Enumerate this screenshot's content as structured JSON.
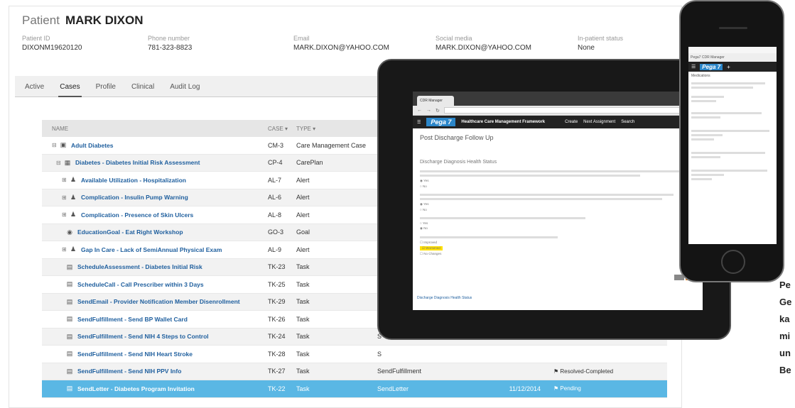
{
  "patient": {
    "label": "Patient",
    "name": "MARK DIXON"
  },
  "header": [
    {
      "label": "Patient ID",
      "value": "DIXONM19620120"
    },
    {
      "label": "Phone number",
      "value": "781-323-8823"
    },
    {
      "label": "Email",
      "value": "MARK.DIXON@YAHOO.COM"
    },
    {
      "label": "Social media",
      "value": "MARK.DIXON@YAHOO.COM"
    },
    {
      "label": "In-patient status",
      "value": "None"
    }
  ],
  "tabs": [
    "Active",
    "Cases",
    "Profile",
    "Clinical",
    "Audit Log"
  ],
  "columns": {
    "name": "NAME",
    "case": "CASE",
    "type": "TYPE"
  },
  "rows": [
    {
      "icon": "folder-icon",
      "name": "Adult Diabetes",
      "case": "CM-3",
      "type": "Care Management Case",
      "sub": "",
      "date": "",
      "status": ""
    },
    {
      "icon": "plan-icon",
      "name": "Diabetes - Diabetes Initial Risk Assessment",
      "case": "CP-4",
      "type": "CarePlan",
      "sub": "",
      "date": "",
      "status": ""
    },
    {
      "icon": "person-icon",
      "name": "Available Utilization - Hospitalization",
      "case": "AL-7",
      "type": "Alert",
      "sub": "",
      "date": "",
      "status": ""
    },
    {
      "icon": "person-icon",
      "name": "Complication - Insulin Pump Warning",
      "case": "AL-6",
      "type": "Alert",
      "sub": "",
      "date": "",
      "status": ""
    },
    {
      "icon": "person-icon",
      "name": "Complication - Presence of Skin Ulcers",
      "case": "AL-8",
      "type": "Alert",
      "sub": "",
      "date": "",
      "status": ""
    },
    {
      "icon": "target-icon",
      "name": "EducationGoal - Eat Right Workshop",
      "case": "GO-3",
      "type": "Goal",
      "sub": "",
      "date": "",
      "status": ""
    },
    {
      "icon": "person-icon",
      "name": "Gap In Care - Lack of SemiAnnual Physical Exam",
      "case": "AL-9",
      "type": "Alert",
      "sub": "",
      "date": "",
      "status": ""
    },
    {
      "icon": "task-icon",
      "name": "ScheduleAssessment - Diabetes Initial Risk",
      "case": "TK-23",
      "type": "Task",
      "sub": "S",
      "date": "",
      "status": ""
    },
    {
      "icon": "task-icon",
      "name": "ScheduleCall - Call Prescriber within 3 Days",
      "case": "TK-25",
      "type": "Task",
      "sub": "S",
      "date": "",
      "status": ""
    },
    {
      "icon": "task-icon",
      "name": "SendEmail - Provider Notification Member Disenrollment",
      "case": "TK-29",
      "type": "Task",
      "sub": "S",
      "date": "",
      "status": ""
    },
    {
      "icon": "task-icon",
      "name": "SendFulfillment - Send BP Wallet Card",
      "case": "TK-26",
      "type": "Task",
      "sub": "S",
      "date": "",
      "status": ""
    },
    {
      "icon": "task-icon",
      "name": "SendFulfillment - Send NIH 4 Steps to Control",
      "case": "TK-24",
      "type": "Task",
      "sub": "S",
      "date": "",
      "status": ""
    },
    {
      "icon": "task-icon",
      "name": "SendFulfillment - Send NIH Heart Stroke",
      "case": "TK-28",
      "type": "Task",
      "sub": "S",
      "date": "",
      "status": ""
    },
    {
      "icon": "task-icon",
      "name": "SendFulfillment - Send NIH PPV Info",
      "case": "TK-27",
      "type": "Task",
      "sub": "SendFulfillment",
      "date": "",
      "status": "Resolved-Completed"
    },
    {
      "icon": "task-icon",
      "name": "SendLetter - Diabetes Program Invitation",
      "case": "TK-22",
      "type": "Task",
      "sub": "SendLetter",
      "date": "11/12/2014",
      "status": "Pending"
    }
  ],
  "tablet": {
    "tab_title": "CDR Manager",
    "brand": "Pega 7",
    "nav_title": "Healthcare Care Management Framework",
    "nav_create": "Create",
    "nav_assignment": "Next Assignment",
    "nav_search": "Search",
    "page_title": "Post Discharge Follow Up",
    "section": "Discharge Diagnosis Health Status",
    "opts": [
      "Yes",
      "No"
    ],
    "checks": [
      "Improved",
      "Worsened",
      "No Changes"
    ],
    "breadcrumb": "Discharge Diagnosis Health Status"
  },
  "phone": {
    "brand": "Pega 7",
    "url": "Pega7 CDR Manager",
    "section": "Medications"
  },
  "side_text": [
    "Pe",
    "Ge",
    "ka",
    "mi",
    "un",
    "Be"
  ],
  "colors": {
    "link": "#1f5f9e",
    "selected": "#5ab7e4",
    "brand": "#2b86c9",
    "highlight": "#ffe000",
    "button_orange": "#f0871e"
  }
}
